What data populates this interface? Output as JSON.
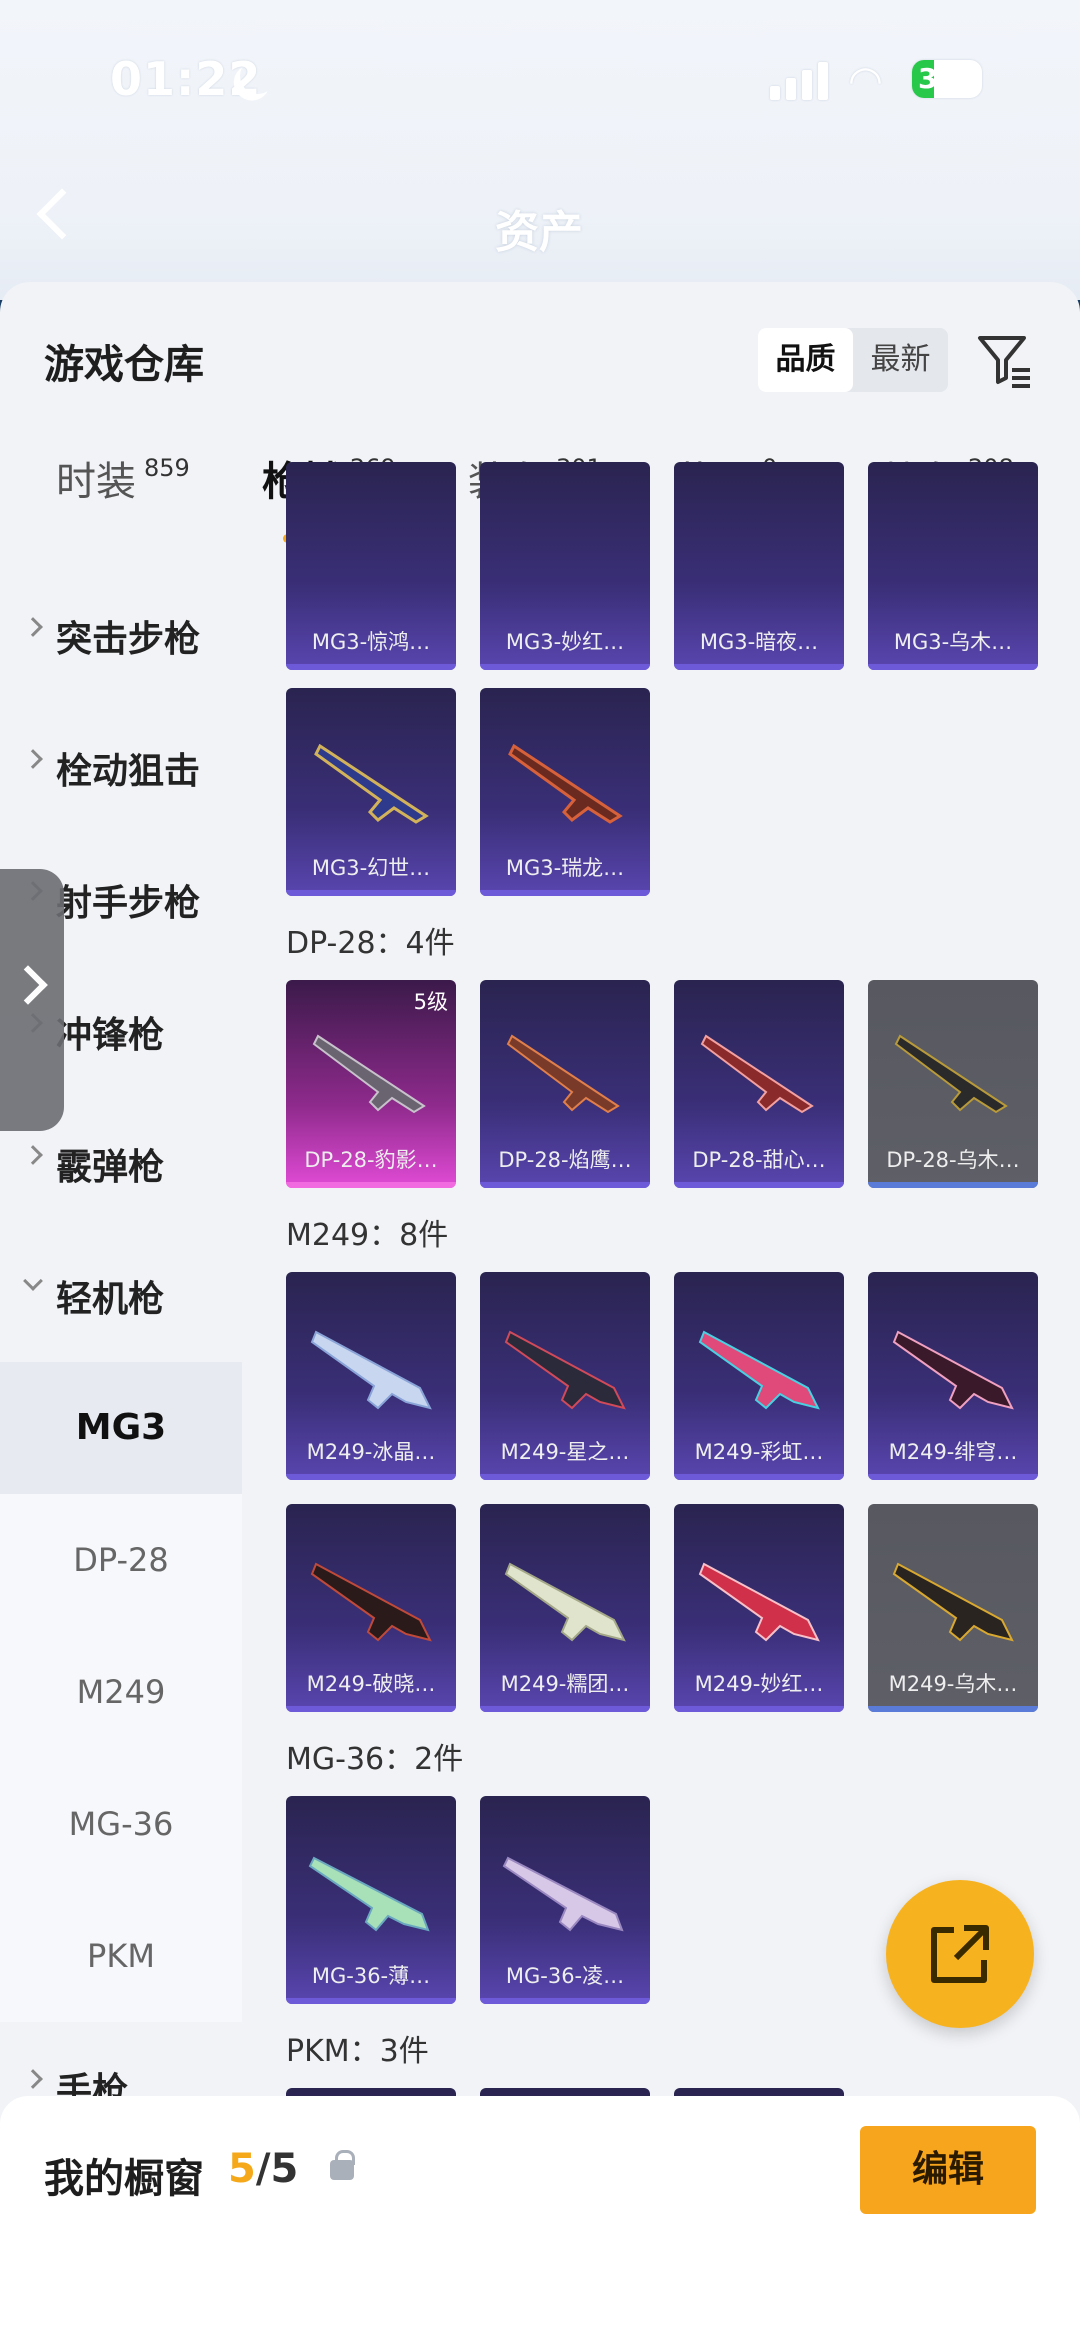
{
  "status": {
    "time": "01:22",
    "battery": "32"
  },
  "header": {
    "title": "资产"
  },
  "panel": {
    "title": "游戏仓库"
  },
  "sort": {
    "quality": "品质",
    "newest": "最新",
    "selected": "品质"
  },
  "tabs": [
    {
      "label": "时装",
      "count": "859"
    },
    {
      "label": "枪械",
      "count": "269"
    },
    {
      "label": "装备",
      "count": "301"
    },
    {
      "label": "载具",
      "count": "0"
    },
    {
      "label": "战备",
      "count": "208"
    }
  ],
  "sidebar": {
    "categories": [
      {
        "label": "突击步枪"
      },
      {
        "label": "栓动狙击"
      },
      {
        "label": "射手步枪"
      },
      {
        "label": "冲锋枪"
      },
      {
        "label": "霰弹枪"
      },
      {
        "label": "轻机枪"
      }
    ],
    "subitems": [
      {
        "label": "MG3"
      },
      {
        "label": "DP-28"
      },
      {
        "label": "M249"
      },
      {
        "label": "MG-36"
      },
      {
        "label": "PKM"
      }
    ],
    "after": {
      "label": "手枪"
    }
  },
  "sections": {
    "dp28": {
      "title": "DP-28：4件"
    },
    "m249": {
      "title": "M249：8件"
    },
    "mg36": {
      "title": "MG-36：2件"
    },
    "pkm": {
      "title": "PKM：3件"
    }
  },
  "cards": {
    "mg3_top": [
      "MG3-惊鸿…",
      "MG3-妙红…",
      "MG3-暗夜…",
      "MG3-乌木…"
    ],
    "mg3": [
      "MG3-幻世…",
      "MG3-瑞龙…"
    ],
    "dp28": [
      "DP-28-豹影…",
      "DP-28-焰鹰…",
      "DP-28-甜心…",
      "DP-28-乌木…"
    ],
    "dp28_level": "5级",
    "m249": [
      "M249-冰晶…",
      "M249-星之…",
      "M249-彩虹…",
      "M249-绯穹…",
      "M249-破晓…",
      "M249-糯团…",
      "M249-妙红…",
      "M249-乌木…"
    ],
    "mg36": [
      "MG-36-薄…",
      "MG-36-凌…"
    ]
  },
  "showcase": {
    "label": "我的橱窗",
    "current": "5",
    "total": "/5",
    "edit_label": "编辑"
  },
  "colors": {
    "accent": "#f7a51c",
    "card_purple": "#3a2f78",
    "card_pink": "#e14bd6",
    "card_grey": "#5e5f67"
  }
}
